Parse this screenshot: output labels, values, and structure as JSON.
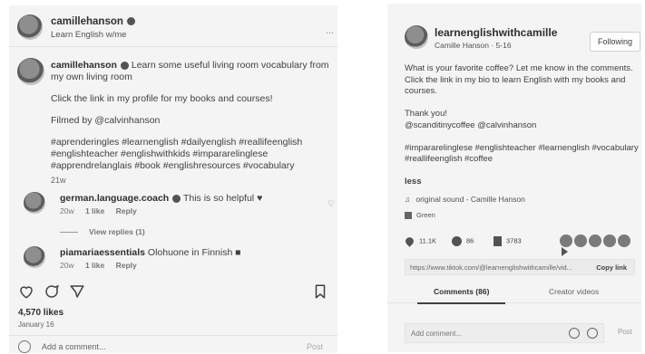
{
  "instagram": {
    "header": {
      "username": "camillehanson",
      "subtitle": "Learn English w/me",
      "more": "..."
    },
    "caption": {
      "username": "camillehanson",
      "text_line": "Learn some useful living room vocabulary from my own living room",
      "link_line": "Click the link in my profile for my books and courses!",
      "filmed_by": "Filmed by @calvinhanson",
      "hashtags": "#aprenderingles #learnenglish #dailyenglish #reallifeenglish #englishteacher #englishwithkids #impararelinglese #apprendrelanglais #book #englishresources #vocabulary",
      "time": "21w"
    },
    "comments": [
      {
        "username": "german.language.coach",
        "text": "This is so helpful",
        "time": "20w",
        "likes": "1 like",
        "reply": "Reply"
      },
      {
        "username": "piamariaessentials",
        "text": "Olohuone in Finnish",
        "time": "20w",
        "likes": "1 like",
        "reply": "Reply"
      }
    ],
    "view_replies": "View replies (1)",
    "likes": "4,570 likes",
    "date": "January 16",
    "add_comment_placeholder": "Add a comment...",
    "post_label": "Post"
  },
  "tiktok": {
    "username": "learnenglishwithcamille",
    "subtitle": "Camille Hanson · 5-16",
    "follow_label": "Following",
    "caption": {
      "p1": "What is your favorite coffee? Let me know in the comments. Click the link in my bio to learn English with my books and courses.",
      "p2a": "Thank you!",
      "p2b": "@scanditinycoffee @calvinhanson",
      "p3": "#impararelinglese #englishteacher #learnenglish #vocabulary #reallifeenglish #coffee",
      "less": "less"
    },
    "sound": "original sound - Camille Hanson",
    "tag_chip": "Green",
    "stats": {
      "likes": "11.1K",
      "comments": "86",
      "saves": "3783"
    },
    "url": "https://www.tiktok.com/@learnenglishwithcamille/vid...",
    "copy_label": "Copy link",
    "tabs": [
      {
        "label": "Comments (86)"
      },
      {
        "label": "Creator videos"
      }
    ],
    "add_comment_placeholder": "Add comment...",
    "post_label": "Post"
  }
}
